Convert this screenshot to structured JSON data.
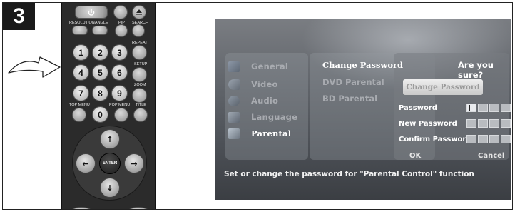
{
  "step": {
    "number": "3"
  },
  "remote": {
    "labels": {
      "resolution": "RESOLUTION",
      "angle": "ANGLE",
      "pip": "PIP",
      "search": "SEARCH",
      "repeat": "REPEAT",
      "setup": "SETUP",
      "zoom": "ZOOM",
      "top_menu": "TOP MENU",
      "pop_menu": "POP MENU",
      "title": "TITLE"
    },
    "number_keys": [
      "1",
      "2",
      "3",
      "4",
      "5",
      "6",
      "7",
      "8",
      "9",
      "0"
    ],
    "enter": "ENTER",
    "arrows": {
      "up": "↑",
      "down": "↓",
      "left": "←",
      "right": "→"
    },
    "icons": {
      "power": "power-icon",
      "eject": "eject-icon"
    }
  },
  "screen": {
    "menu": [
      {
        "label": "General",
        "icon": "general-icon",
        "active": false
      },
      {
        "label": "Video",
        "icon": "video-icon",
        "active": false
      },
      {
        "label": "Audio",
        "icon": "audio-icon",
        "active": false
      },
      {
        "label": "Language",
        "icon": "language-icon",
        "active": false
      },
      {
        "label": "Parental",
        "icon": "parental-icon",
        "active": true
      }
    ],
    "submenu": [
      {
        "label": "Change Password",
        "active": true
      },
      {
        "label": "DVD Parental",
        "active": false
      },
      {
        "label": "BD Parental",
        "active": false
      }
    ],
    "dialog": {
      "title": "Are you sure?",
      "change_button": "Change Password",
      "fields": [
        {
          "label": "Password"
        },
        {
          "label": "New Password"
        },
        {
          "label": "Confirm Password"
        }
      ],
      "ok": "OK",
      "cancel": "Cancel"
    },
    "footer": "Set or change the password for \"Parental Control\" function"
  },
  "colors": {
    "badge_bg": "#1a1a1a",
    "remote_body": "#2b2b2b",
    "screen_bg": "#62666c",
    "active_text": "#ffffff",
    "inactive_text": "#a8abb0"
  }
}
